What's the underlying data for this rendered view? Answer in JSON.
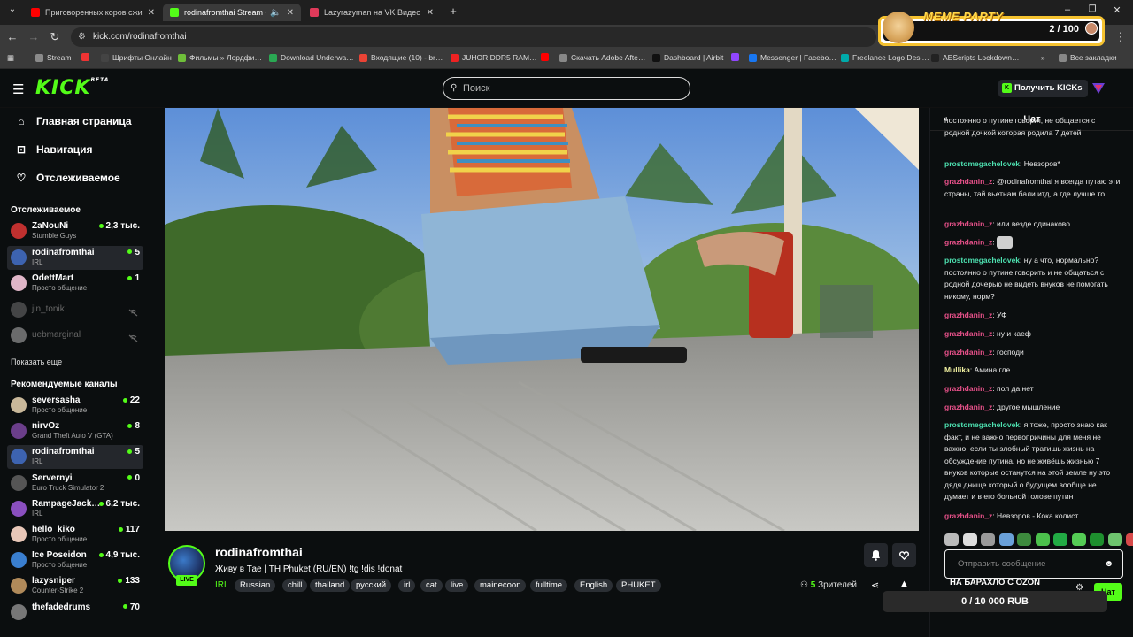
{
  "browser": {
    "tabs": [
      {
        "title": "Приговоренных коров сжигаю…",
        "favicon_color": "#ff0000"
      },
      {
        "title": "rodinafromthai Stream - Wa…",
        "favicon_color": "#53fc18"
      },
      {
        "title": "Lazyrazyman на VK Видео Live…",
        "favicon_color": "#e03a5a"
      }
    ],
    "new_tab": "+",
    "url": "kick.com/rodinafromthai",
    "bookmarks": [
      {
        "label": "Stream",
        "color": "#8a8a8a"
      },
      {
        "label": "",
        "color": "#e33"
      },
      {
        "label": "Шрифты Онлайн",
        "color": "#444"
      },
      {
        "label": "Фильмы » Лордфи…",
        "color": "#6fbf3a"
      },
      {
        "label": "Download Underwa…",
        "color": "#2aa853"
      },
      {
        "label": "Входящие (10) - br…",
        "color": "#ea4335"
      },
      {
        "label": "JUHOR DDR5 RAM…",
        "color": "#e22"
      },
      {
        "label": "Скачать Adobe Afte…",
        "color": "#888"
      },
      {
        "label": "Dashboard | Airbit",
        "color": "#111"
      },
      {
        "label": "",
        "color": "#9146ff"
      },
      {
        "label": "Messenger | Facebo…",
        "color": "#1877f2"
      },
      {
        "label": "Freelance Logo Desi…",
        "color": "#0aa"
      },
      {
        "label": "AEScripts Lockdown…",
        "color": "#222"
      },
      {
        "label": "Все закладки",
        "color": "#888"
      }
    ]
  },
  "overlay": {
    "title": "MEME PARTY",
    "count": "2 / 100",
    "goal": "0 / 10 000 RUB"
  },
  "header": {
    "logo": "KICK",
    "logo_beta": "BETA",
    "search_placeholder": "Поиск",
    "get_kicks": "Получить KICKs"
  },
  "sidebar": {
    "nav": [
      {
        "label": "Главная страница",
        "icon": "home-icon"
      },
      {
        "label": "Навигация",
        "icon": "compass-icon"
      },
      {
        "label": "Отслеживаемое",
        "icon": "heart-icon"
      }
    ],
    "followed_title": "Отслеживаемое",
    "followed": [
      {
        "name": "ZaNouNi",
        "category": "Stumble Guys",
        "viewers": "2,3 тыс.",
        "live": true,
        "avatar_color": "#c0302f"
      },
      {
        "name": "rodinafromthai",
        "category": "IRL",
        "viewers": "5",
        "live": true,
        "avatar_color": "#3d63b0",
        "selected": true
      },
      {
        "name": "OdettMart",
        "category": "Просто общение",
        "viewers": "1",
        "live": true,
        "avatar_color": "#e0b6c8"
      },
      {
        "name": "jin_tonik",
        "category": "",
        "viewers": "",
        "live": false,
        "avatar_color": "#8a8a8a"
      },
      {
        "name": "uebmarginal",
        "category": "",
        "viewers": "",
        "live": false,
        "avatar_color": "#dddddd"
      }
    ],
    "show_more": "Показать еще",
    "recommended_title": "Рекомендуемые каналы",
    "recommended": [
      {
        "name": "seversasha",
        "category": "Просто общение",
        "viewers": "22",
        "avatar_color": "#c9b89a"
      },
      {
        "name": "nirvOz",
        "category": "Grand Theft Auto V (GTA)",
        "viewers": "8",
        "avatar_color": "#6b3e8a"
      },
      {
        "name": "rodinafromthai",
        "category": "IRL",
        "viewers": "5",
        "avatar_color": "#3d63b0",
        "selected": true
      },
      {
        "name": "Servernyi",
        "category": "Euro Truck Simulator 2",
        "viewers": "0",
        "avatar_color": "#555555"
      },
      {
        "name": "RampageJack…",
        "category": "IRL",
        "viewers": "6,2 тыс.",
        "avatar_color": "#8a4fbf"
      },
      {
        "name": "hello_kiko",
        "category": "Просто общение",
        "viewers": "117",
        "avatar_color": "#e8c7b8"
      },
      {
        "name": "Ice Poseidon",
        "category": "Просто общение",
        "viewers": "4,9 тыс.",
        "avatar_color": "#3a7fd0"
      },
      {
        "name": "lazysniper",
        "category": "Counter-Strike 2",
        "viewers": "133",
        "avatar_color": "#b08a5a"
      },
      {
        "name": "thefadedrums",
        "category": "",
        "viewers": "70",
        "avatar_color": "#777777"
      }
    ]
  },
  "stream": {
    "name": "rodinafromthai",
    "live": "LIVE",
    "title": "Живу в Тае | TH Phuket (RU/EN) !tg !dis !donat",
    "category": "IRL",
    "tags": [
      "Russian",
      "chill",
      "thailand",
      "русский",
      "irl",
      "cat",
      "live",
      "mainecoon",
      "fulltime",
      "English",
      "PHUKET"
    ],
    "viewers_count": "5",
    "viewers_label": "Зрителей"
  },
  "chat": {
    "title": "Чат",
    "messages": [
      {
        "user": "",
        "text": "постоянно о путине говорит, не общается с родной дочкой которая родила 7 детей",
        "color": "#e8e8e8"
      },
      {
        "user": "prostomegachelovek",
        "text": "Невзоров*",
        "color": "#4de0b0"
      },
      {
        "user": "grazhdanin_z",
        "text": "@rodinafromthai я всегда путаю эти страны, тай вьетнам бали итд, а где лучше то",
        "color": "#e8518a"
      },
      {
        "user": "grazhdanin_z",
        "text": "или везде одинаково",
        "color": "#e8518a"
      },
      {
        "user": "grazhdanin_z",
        "text": "",
        "color": "#e8518a",
        "emote": true
      },
      {
        "user": "prostomegachelovek",
        "text": "ну а что, нормально? постоянно о путине говорить и не общаться с родной дочерью не видеть внуков не помогать никому, норм?",
        "color": "#4de0b0"
      },
      {
        "user": "grazhdanin_z",
        "text": "УФ",
        "color": "#e8518a"
      },
      {
        "user": "grazhdanin_z",
        "text": "ну и каеф",
        "color": "#e8518a"
      },
      {
        "user": "grazhdanin_z",
        "text": "господи",
        "color": "#e8518a"
      },
      {
        "user": "Mullika",
        "text": "Амина гле",
        "color": "#f0f0a0"
      },
      {
        "user": "grazhdanin_z",
        "text": "пол да нет",
        "color": "#e8518a"
      },
      {
        "user": "grazhdanin_z",
        "text": "другое мышление",
        "color": "#e8518a"
      },
      {
        "user": "prostomegachelovek",
        "text": "я тоже, просто знаю как факт, и не важно первопричины для меня не важно, если ты злобный тратишь жизнь на обсуждение путина, но не живёшь жизнью 7 внуков которые останутся на этой земле ну это дядя днище который о будущем вообще не думает и в его больной голове путин",
        "color": "#4de0b0"
      },
      {
        "user": "grazhdanin_z",
        "text": "Невзоров - Кока колист",
        "color": "#e8518a"
      }
    ],
    "input_placeholder": "Отправить сообщение",
    "promo": "НА БАРАХЛО С OZON",
    "send_label": "Чат"
  }
}
